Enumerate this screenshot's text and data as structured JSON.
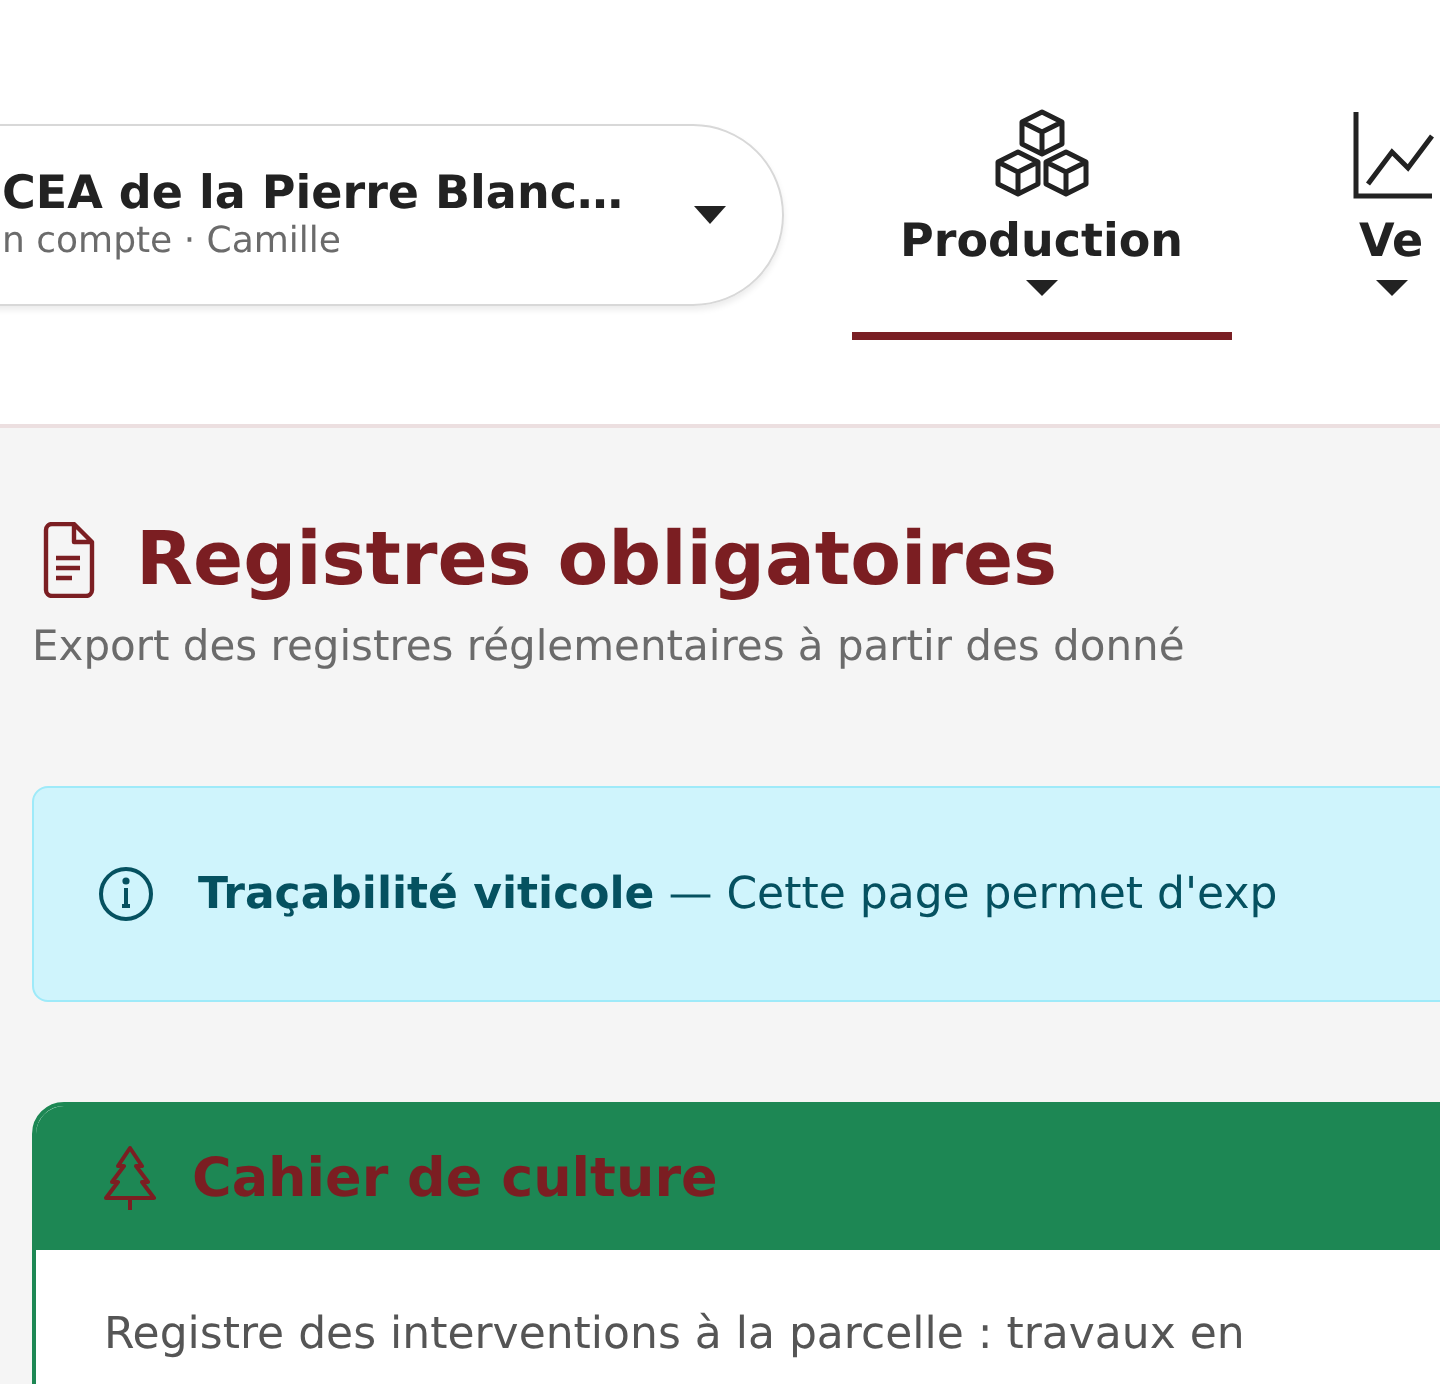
{
  "account_switcher": {
    "name": "CEA de la Pierre Blanc…",
    "subtitle": "n compte · Camille"
  },
  "nav": [
    {
      "kind": "cubes",
      "label": "Production",
      "selected": true
    },
    {
      "kind": "chart",
      "label": "Ve",
      "selected": false
    }
  ],
  "page": {
    "title": "Registres obligatoires",
    "subtitle": "Export des registres réglementaires à partir des donné"
  },
  "notice": {
    "text": "**Traçabilité viticole** — Cette page permet d'exp"
  },
  "cards": [
    {
      "title": "Cahier de culture",
      "description": "Registre des interventions à la parcelle : travaux en"
    }
  ]
}
